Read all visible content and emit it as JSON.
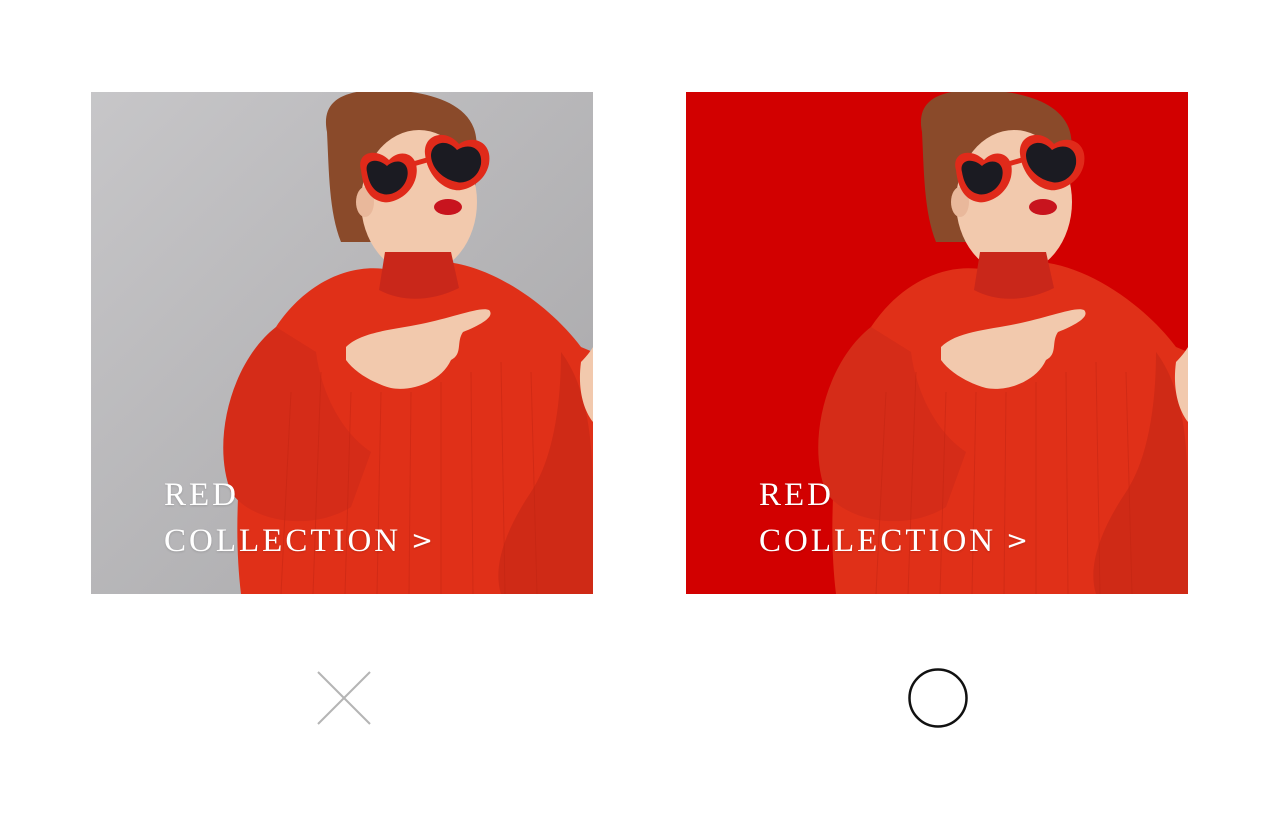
{
  "comparison": {
    "bad_example": {
      "background_color": "#b4b3b6",
      "caption_line1": "RED",
      "caption_line2": "COLLECTION",
      "caption_arrow": ">",
      "verdict_icon": "cross-icon"
    },
    "good_example": {
      "background_color": "#d20000",
      "caption_line1": "RED",
      "caption_line2": "COLLECTION",
      "caption_arrow": ">",
      "verdict_icon": "circle-icon"
    }
  },
  "colors": {
    "sweater": "#e03018",
    "skin": "#f2c9ad",
    "hair": "#8a4a2a",
    "lenses": "#1b1b22",
    "frames": "#e02a1a",
    "lips": "#c8141e"
  }
}
